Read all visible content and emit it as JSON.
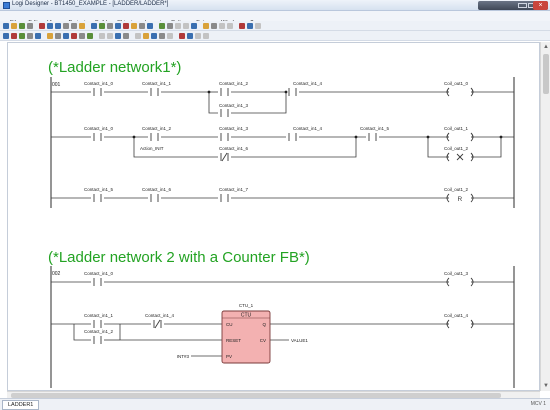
{
  "window": {
    "title": "Logi Designer - BT1450_EXAMPLE - [LADDER/LADDER*]",
    "status_tab": "LADDER1",
    "status_right": "MCV 1"
  },
  "menu": [
    "File",
    "Edit",
    "View",
    "Project",
    "Build",
    "Objects",
    "Layout",
    "Online",
    "Extras",
    "Window",
    "?"
  ],
  "toolbar": {
    "t1_icons": [
      "#3a6fb0",
      "#d9a23a",
      "#5a8f3a",
      "#8a8a8a",
      "#b03a3a",
      "#3a6fb0",
      "#3a6fb0",
      "#8a8a8a",
      "#8a8a8a",
      "#d9a23a",
      "#3a6fb0",
      "#5a8f3a",
      "#8a8a8a",
      "#3a6fb0",
      "#b03a3a",
      "#d9a23a",
      "#8a8a8a",
      "#3a6fb0",
      "#5a8f3a",
      "#8a8a8a",
      "#c3c3c3",
      "#c3c3c3",
      "#3a6fb0",
      "#d9a23a",
      "#8a8a8a",
      "#c3c3c3",
      "#c3c3c3",
      "#b03a3a",
      "#3a6fb0",
      "#c3c3c3"
    ],
    "t2_icons": [
      "#3a6fb0",
      "#b03a3a",
      "#5a8f3a",
      "#8a8a8a",
      "#3a6fb0",
      "#d9a23a",
      "#8a8a8a",
      "#3a6fb0",
      "#b03a3a",
      "#8a8a8a",
      "#5a8f3a",
      "#c3c3c3",
      "#c3c3c3",
      "#3a6fb0",
      "#8a8a8a",
      "#c3c3c3",
      "#d9a23a",
      "#3a6fb0",
      "#8a8a8a",
      "#c3c3c3",
      "#b03a3a",
      "#3a6fb0",
      "#c3c3c3",
      "#c3c3c3"
    ]
  },
  "network1": {
    "comment": "(*Ladder network1*)",
    "number": "001",
    "labels": {
      "c0": "Contact_in1_0",
      "c1": "Contact_in1_1",
      "c2": "Contact_in1_2",
      "c4": "Contact_in1_4",
      "c3": "Contact_in1_3",
      "coil0": "Coil_out1_0",
      "r2_c0": "Contact_in1_0",
      "r2_c2": "Contact_in1_2",
      "r2_c3": "Contact_in1_3",
      "r2_c4": "Contact_in1_4",
      "r2_c5": "Contact_in1_5",
      "coil1": "Coil_out1_1",
      "action": "Action_INIT",
      "c6": "Contact_in1_6",
      "coil2": "Coil_out1_2",
      "r4_c5": "Contact_in1_5",
      "r4_c6": "Contact_in1_6",
      "r4_c7": "Contact_in1_7",
      "r4_coil": "Coil_out1_2"
    }
  },
  "network2": {
    "comment": "(*Ladder network 2 with a Counter FB*)",
    "number": "002",
    "labels": {
      "c0": "Contact_in1_0",
      "coil3": "Coil_out1_3",
      "c1": "Contact_in1_1",
      "c4": "Contact_in1_4",
      "c2": "Contact_in1_2",
      "coil4": "Coil_out1_4",
      "fb_instance": "CTU_1",
      "fb_type": "CTU",
      "pin_cu": "CU",
      "pin_q": "Q",
      "pin_reset": "RESET",
      "pin_cv": "CV",
      "pin_pv": "PV",
      "pv_value": "INT#3",
      "cv_var": "VALUE1"
    }
  },
  "colors": {
    "comment": "#23a323",
    "wire": "#3c3c3c",
    "fb_fill": "#f3b1b1",
    "fb_header": "#f7c7c7",
    "fb_border": "#7a3a3a",
    "rail": "#2b2b2b"
  }
}
